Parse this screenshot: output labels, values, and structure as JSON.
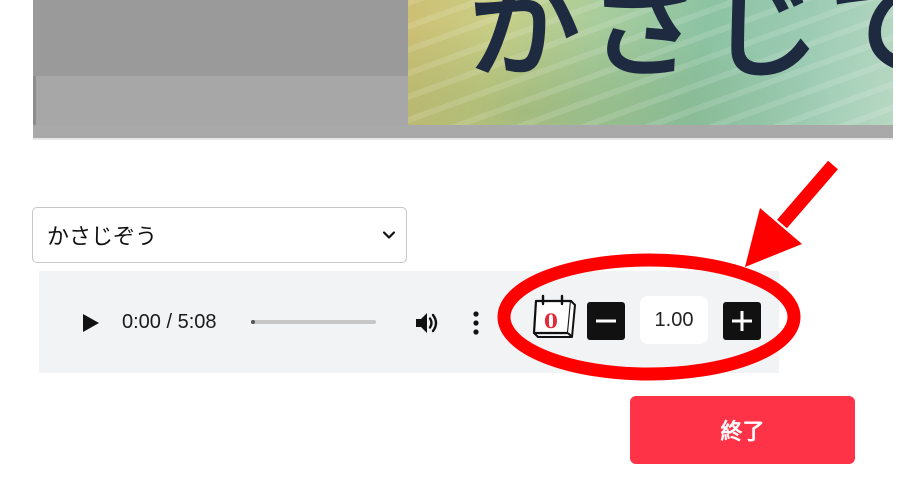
{
  "slide": {
    "heading_fragment": "かさじて"
  },
  "voice_select": {
    "selected": "かさじぞう"
  },
  "audio_player": {
    "time_display": "0:00 / 5:08",
    "progress": 0.0,
    "play_icon": "play-icon",
    "volume_icon": "volume-icon",
    "more_icon": "more-vert-icon"
  },
  "counter": {
    "value": "0",
    "icon": "calendar-counter-icon"
  },
  "speed": {
    "value": "1.00",
    "minus_icon": "minus-icon",
    "plus_icon": "plus-icon"
  },
  "end_button": {
    "label": "終了"
  },
  "colors": {
    "accent": "#ff3348",
    "annotation": "#ff0000",
    "counter_text": "#e12a3a"
  }
}
